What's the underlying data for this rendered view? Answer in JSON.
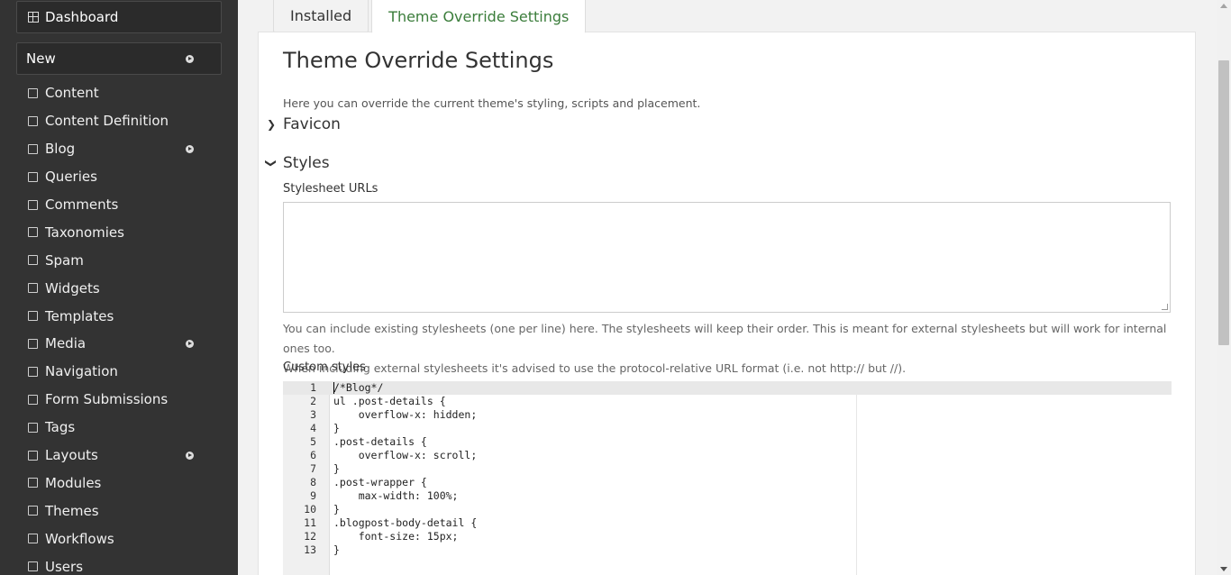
{
  "sidebar": {
    "dashboard_label": "Dashboard",
    "new_label": "New",
    "items": [
      {
        "label": "Content",
        "icon": "document-icon"
      },
      {
        "label": "Content Definition",
        "icon": "puzzle-icon"
      },
      {
        "label": "Blog",
        "icon": "document-icon",
        "has_submenu": true
      },
      {
        "label": "Queries",
        "icon": "filter-icon"
      },
      {
        "label": "Comments",
        "icon": "comment-icon"
      },
      {
        "label": "Taxonomies",
        "icon": "tags-icon"
      },
      {
        "label": "Spam",
        "icon": "box-icon"
      },
      {
        "label": "Widgets",
        "icon": "list-icon"
      },
      {
        "label": "Templates",
        "icon": "code-icon"
      },
      {
        "label": "Media",
        "icon": "image-icon",
        "has_submenu": true
      },
      {
        "label": "Navigation",
        "icon": "list-icon"
      },
      {
        "label": "Form Submissions",
        "icon": "list-icon"
      },
      {
        "label": "Tags",
        "icon": "tag-icon"
      },
      {
        "label": "Layouts",
        "icon": "layout-icon",
        "has_submenu": true
      },
      {
        "label": "Modules",
        "icon": "plug-icon"
      },
      {
        "label": "Themes",
        "icon": "theme-icon",
        "active": true
      },
      {
        "label": "Workflows",
        "icon": "sitemap-icon"
      },
      {
        "label": "Users",
        "icon": "user-icon"
      }
    ]
  },
  "tabs": [
    {
      "label": "Installed"
    },
    {
      "label": "Theme Override Settings",
      "active": true
    }
  ],
  "main": {
    "title": "Theme Override Settings",
    "intro": "Here you can override the current theme's styling, scripts and placement.",
    "favicon_label": "Favicon",
    "styles_label": "Styles",
    "stylesheet_urls_label": "Stylesheet URLs",
    "stylesheet_urls_value": "",
    "help_line1": "You can include existing stylesheets (one per line) here. The stylesheets will keep their order. This is meant for external stylesheets but will work for internal ones too.",
    "help_line2": "When including external stylesheets it's advised to use the protocol-relative URL format (i.e. not http:// but //).",
    "custom_styles_label": "Custom styles",
    "code_lines": [
      "/*Blog*/",
      "ul .post-details {",
      "    overflow-x: hidden;",
      "}",
      ".post-details {",
      "    overflow-x: scroll;",
      "}",
      ".post-wrapper {",
      "    max-width: 100%;",
      "}",
      ".blogpost-body-detail {",
      "    font-size: 15px;",
      "}"
    ]
  },
  "colors": {
    "sidebar_bg": "#333333",
    "active_tab_text": "#3b7d3b"
  }
}
